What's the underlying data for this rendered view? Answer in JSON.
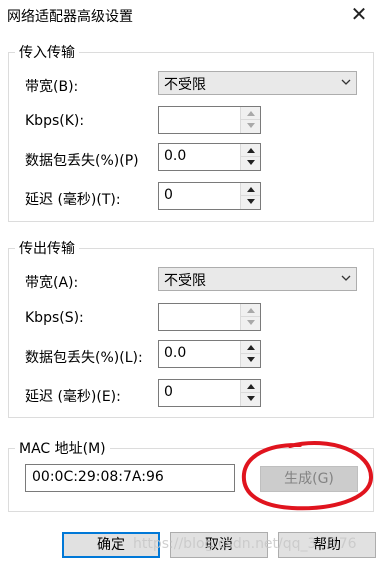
{
  "window": {
    "title": "网络适配器高级设置",
    "close_glyph": "✕"
  },
  "incoming": {
    "legend": "传入传输",
    "bandwidth_label": "带宽(B):",
    "bandwidth_value": "不受限",
    "kbps_label": "Kbps(K):",
    "kbps_value": "",
    "loss_label": "数据包丢失(%)(P)",
    "loss_value": "0.0",
    "latency_label": "延迟 (毫秒)(T):",
    "latency_value": "0"
  },
  "outgoing": {
    "legend": "传出传输",
    "bandwidth_label": "带宽(A):",
    "bandwidth_value": "不受限",
    "kbps_label": "Kbps(S):",
    "kbps_value": "",
    "loss_label": "数据包丢失(%)(L):",
    "loss_value": "0.0",
    "latency_label": "延迟 (毫秒)(E):",
    "latency_value": "0"
  },
  "mac": {
    "legend": "MAC 地址(M)",
    "value": "00:0C:29:08:7A:96",
    "generate_label": "生成(G)"
  },
  "buttons": {
    "ok": "确定",
    "cancel": "取消",
    "help": "帮助"
  },
  "watermark": "https://blog.csdn.net/qq_3...176",
  "colors": {
    "accent": "#0078d7",
    "annotation": "#e0141e"
  },
  "icons": {
    "close": "close-icon",
    "dropdown": "chevron-down-icon",
    "spin_up": "arrow-up-icon",
    "spin_down": "arrow-down-icon"
  }
}
